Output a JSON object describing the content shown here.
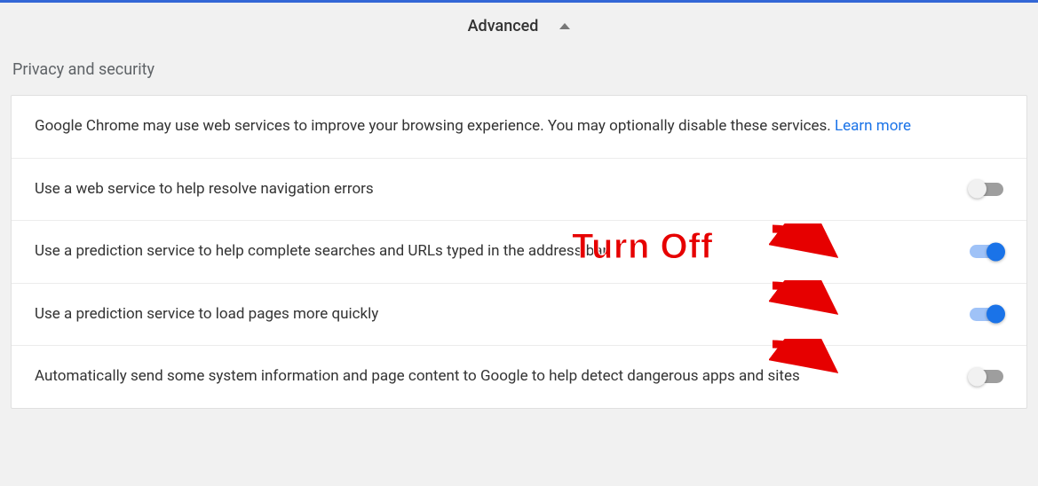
{
  "header": {
    "advanced": "Advanced"
  },
  "section": {
    "title": "Privacy and security",
    "info_text": "Google Chrome may use web services to improve your browsing experience. You may optionally disable these services. ",
    "learn_more": "Learn more"
  },
  "settings": [
    {
      "label": "Use a web service to help resolve navigation errors",
      "enabled": false
    },
    {
      "label": "Use a prediction service to help complete searches and URLs typed in the address bar",
      "enabled": true
    },
    {
      "label": "Use a prediction service to load pages more quickly",
      "enabled": true
    },
    {
      "label": "Automatically send some system information and page content to Google to help detect dangerous apps and sites",
      "enabled": false
    }
  ],
  "annotation": {
    "label": "Turn Off"
  }
}
